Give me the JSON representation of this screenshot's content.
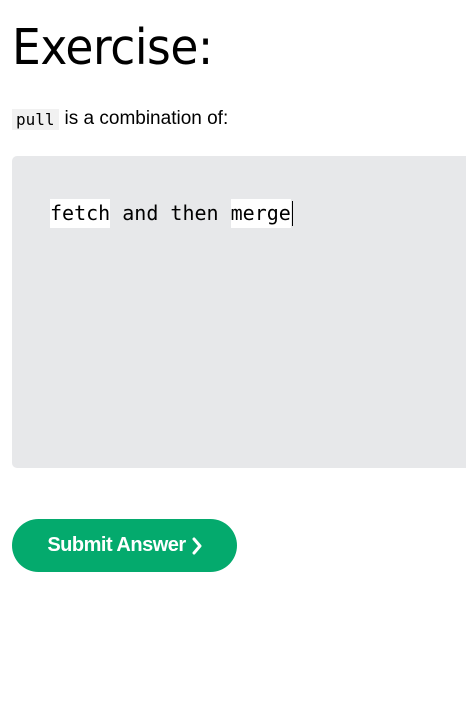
{
  "heading": "Exercise:",
  "prompt": {
    "code": "pull",
    "text": "is a combination of:"
  },
  "editor": {
    "answer_1": "fetch",
    "connector": " and then ",
    "answer_2": "merge"
  },
  "submit": {
    "label": "Submit Answer",
    "icon": "chevron-right-icon"
  },
  "colors": {
    "button": "#04aa6d",
    "editor_background": "#e7e8ea",
    "input_background": "#ffffff"
  }
}
